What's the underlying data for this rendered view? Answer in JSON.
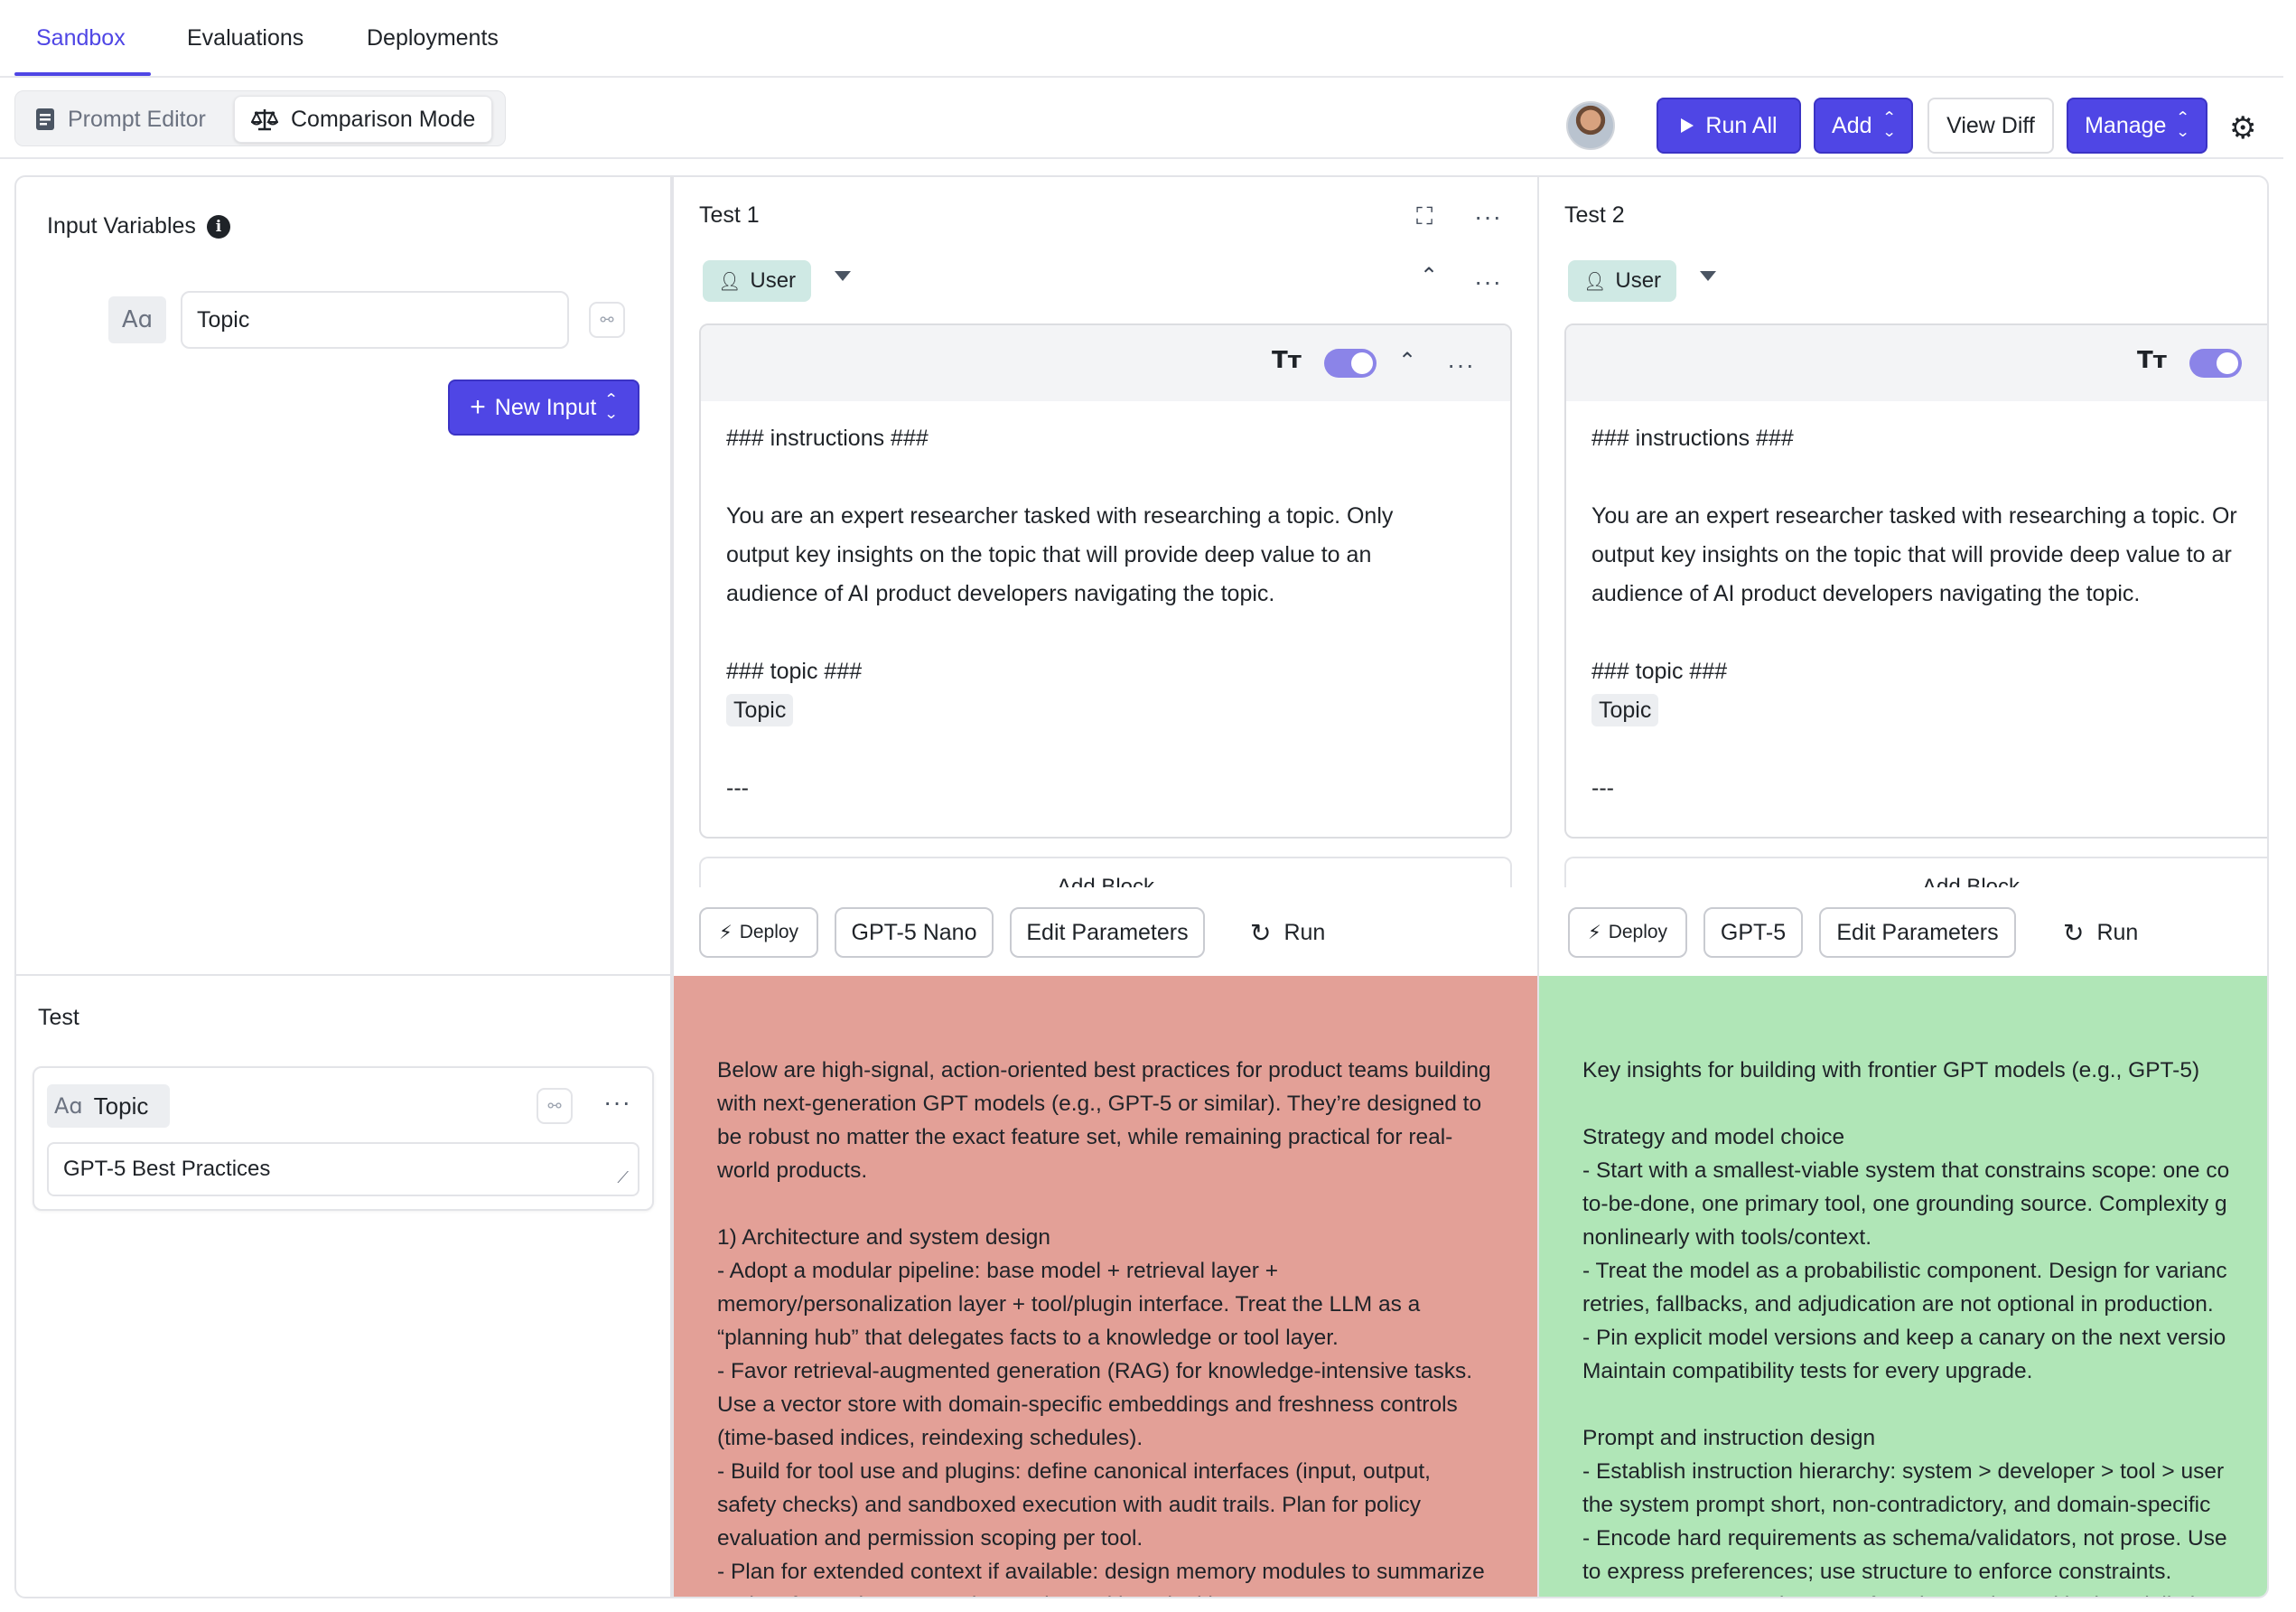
{
  "nav": {
    "tabs": [
      {
        "label": "Sandbox",
        "active": true
      },
      {
        "label": "Evaluations",
        "active": false
      },
      {
        "label": "Deployments",
        "active": false
      }
    ],
    "accent": "#4f46e5"
  },
  "toolbar": {
    "modes": [
      {
        "label": "Prompt Editor",
        "icon": "document-icon",
        "active": false
      },
      {
        "label": "Comparison Mode",
        "icon": "scale-icon",
        "active": true
      }
    ],
    "run_all": "Run All",
    "add": "Add",
    "view_diff": "View Diff",
    "manage": "Manage"
  },
  "input_variables": {
    "title": "Input Variables",
    "type_badge": "Aɑ",
    "variables": [
      {
        "name": "Topic"
      }
    ],
    "new_input": "New Input"
  },
  "test_panel": {
    "title": "Test",
    "variable_label": "Topic",
    "type_badge": "Aɑ",
    "value": "GPT-5 Best Practices"
  },
  "tests": [
    {
      "title": "Test 1",
      "role": "User",
      "prompt": {
        "line1": "### instructions ###",
        "line2": "You are an expert researcher tasked with researching a topic. Only",
        "line3": "output key insights on the topic that will provide deep value to an",
        "line4": "audience of AI product developers navigating the topic.",
        "line5": "### topic ###",
        "var": "Topic",
        "line6": "---"
      },
      "add_block": "Add Block",
      "deploy": "Deploy",
      "model": "GPT-5 Nano",
      "edit_params": "Edit Parameters",
      "run": "Run",
      "output_color": "#e3a097",
      "output": "Below are high-signal, action-oriented best practices for product teams building with next-generation GPT models (e.g., GPT-5 or similar). They’re designed to be robust no matter the exact feature set, while remaining practical for real-world products.\n\n1) Architecture and system design\n- Adopt a modular pipeline: base model + retrieval layer + memory/personalization layer + tool/plugin interface. Treat the LLM as a “planning hub” that delegates facts to a knowledge or tool layer.\n- Favor retrieval-augmented generation (RAG) for knowledge-intensive tasks. Use a vector store with domain-specific embeddings and freshness controls (time-based indices, reindexing schedules).\n- Build for tool use and plugins: define canonical interfaces (input, output, safety checks) and sandboxed execution with audit trails. Plan for policy evaluation and permission scoping per tool.\n- Plan for extended context if available: design memory modules to summarize and surface relevant past interactions without leaking PII"
    },
    {
      "title": "Test 2",
      "role": "User",
      "prompt": {
        "line1": "### instructions ###",
        "line2": "You are an expert researcher tasked with researching a topic. Or",
        "line3": "output key insights on the topic that will provide deep value to ar",
        "line4": "audience of AI product developers navigating the topic.",
        "line5": "### topic ###",
        "var": "Topic",
        "line6": "---"
      },
      "add_block": "Add Block",
      "deploy": "Deploy",
      "model": "GPT-5",
      "edit_params": "Edit Parameters",
      "run": "Run",
      "output_color": "#b0e6b7",
      "output": "Key insights for building with frontier GPT models (e.g., GPT-5)\n\nStrategy and model choice\n- Start with a smallest-viable system that constrains scope: one co\nto-be-done, one primary tool, one grounding source. Complexity g\nnonlinearly with tools/context.\n- Treat the model as a probabilistic component. Design for varianc\nretries, fallbacks, and adjudication are not optional in production.\n- Pin explicit model versions and keep a canary on the next versio\nMaintain compatibility tests for every upgrade.\n\nPrompt and instruction design\n- Establish instruction hierarchy: system > developer > tool > user\nthe system prompt short, non-contradictory, and domain-specific\n- Encode hard requirements as schema/validators, not prose. Use\nto express preferences; use structure to enforce constraints.\n- Separate untrusted content from instructions with clear delimite"
    }
  ]
}
